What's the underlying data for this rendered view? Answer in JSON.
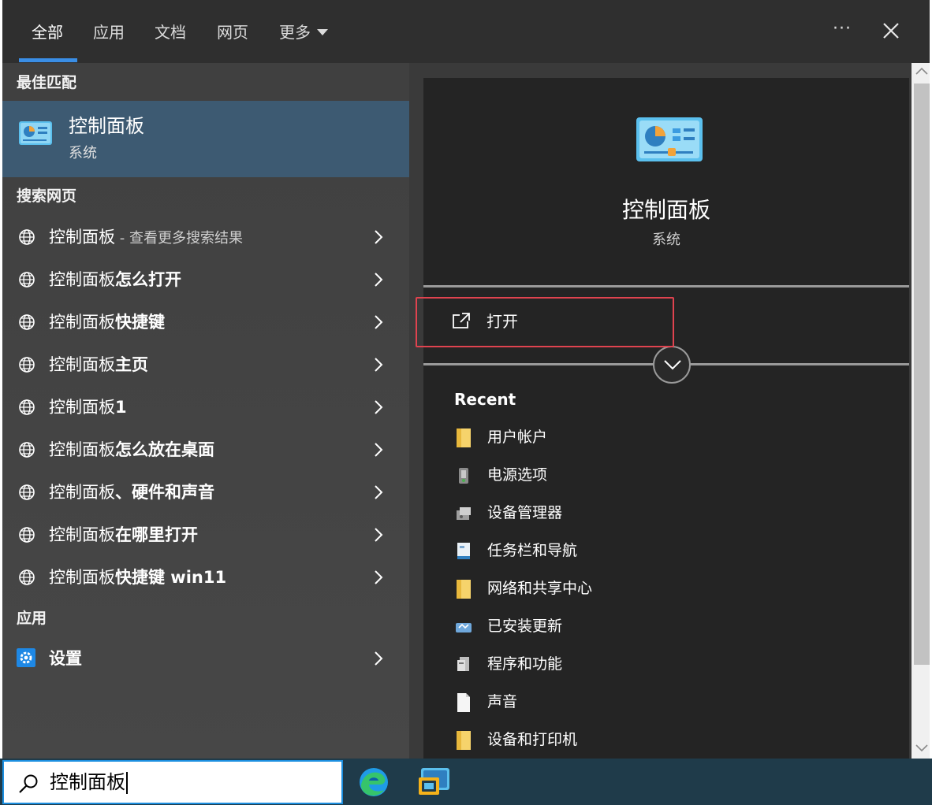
{
  "tabs": [
    {
      "label": "全部",
      "active": true
    },
    {
      "label": "应用",
      "active": false
    },
    {
      "label": "文档",
      "active": false
    },
    {
      "label": "网页",
      "active": false
    },
    {
      "label": "更多",
      "active": false
    }
  ],
  "topbar": {
    "more_label": "···",
    "close_icon": "close-icon"
  },
  "left": {
    "best_match_heading": "最佳匹配",
    "best_match": {
      "title": "控制面板",
      "subtitle": "系统",
      "icon": "control-panel-icon"
    },
    "web_heading": "搜索网页",
    "web_results": [
      {
        "normal": "控制面板",
        "bold": "",
        "extra": " - 查看更多搜索结果"
      },
      {
        "normal": "控制面板",
        "bold": "怎么打开",
        "extra": ""
      },
      {
        "normal": "控制面板",
        "bold": "快捷键",
        "extra": ""
      },
      {
        "normal": "控制面板",
        "bold": "主页",
        "extra": ""
      },
      {
        "normal": "控制面板",
        "bold": "1",
        "extra": ""
      },
      {
        "normal": "控制面板",
        "bold": "怎么放在桌面",
        "extra": ""
      },
      {
        "normal": "控制面板",
        "bold": "、硬件和声音",
        "extra": ""
      },
      {
        "normal": "控制面板",
        "bold": "在哪里打开",
        "extra": ""
      },
      {
        "normal": "控制面板",
        "bold": "快捷键 win11",
        "extra": ""
      }
    ],
    "apps_heading": "应用",
    "apps": [
      {
        "label": "设置",
        "icon": "gear-icon"
      }
    ]
  },
  "preview": {
    "title": "控制面板",
    "subtitle": "系统",
    "open_label": "打开",
    "recent_heading": "Recent",
    "recent": [
      {
        "label": "用户帐户",
        "icon": "folder-icon"
      },
      {
        "label": "电源选项",
        "icon": "power-icon"
      },
      {
        "label": "设备管理器",
        "icon": "device-manager-icon"
      },
      {
        "label": "任务栏和导航",
        "icon": "taskbar-icon"
      },
      {
        "label": "网络和共享中心",
        "icon": "folder-icon"
      },
      {
        "label": "已安装更新",
        "icon": "updates-icon"
      },
      {
        "label": "程序和功能",
        "icon": "programs-icon"
      },
      {
        "label": "声音",
        "icon": "file-icon"
      },
      {
        "label": "设备和打印机",
        "icon": "folder-icon"
      }
    ]
  },
  "taskbar": {
    "search_value": "控制面板",
    "apps": [
      "edge-icon",
      "control-panel-icon"
    ]
  },
  "colors": {
    "accent": "#3a8ee6",
    "selected_row": "#3d5a72",
    "highlight_box": "#e0434f",
    "taskbar": "#1f3b4a"
  }
}
